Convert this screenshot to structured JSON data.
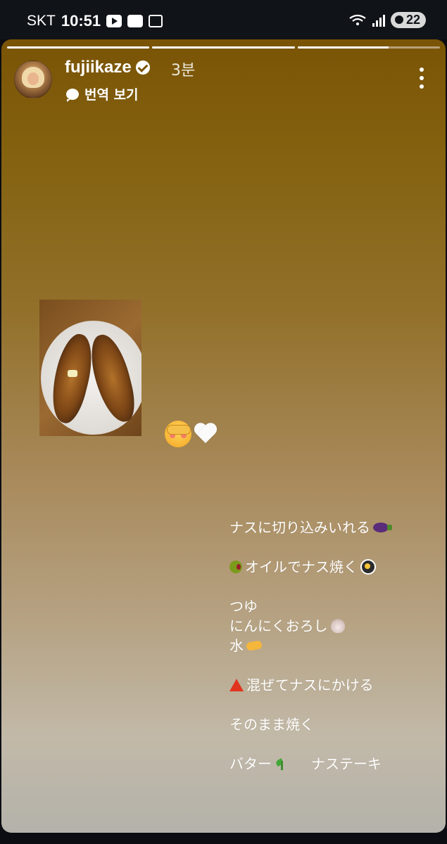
{
  "status_bar": {
    "carrier": "SKT",
    "time": "10:51",
    "battery": "22"
  },
  "story": {
    "username": "fujiikaze",
    "time_ago": "3분",
    "translate_label": "번역 보기",
    "progress": [
      1.0,
      1.0,
      0.64
    ],
    "recipe_lines": [
      "ナスに切り込みいれる",
      "オイルでナス焼く",
      "つゆ",
      "にんにくおろし",
      "水",
      "混ぜてナスにかける",
      "そのまま焼く",
      "バター",
      "ナステーキ"
    ]
  },
  "colors": {
    "story_top": "#7a5406",
    "story_bottom": "#b4b2ab",
    "accent_text": "#ffffff"
  }
}
